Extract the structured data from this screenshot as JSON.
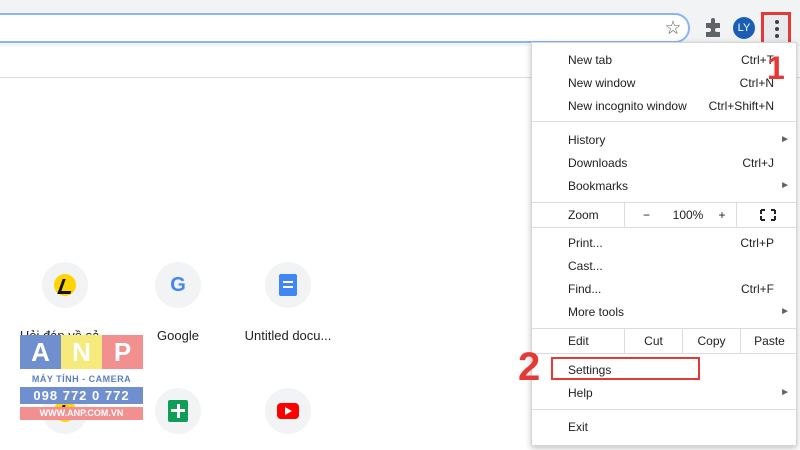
{
  "toolbar": {
    "avatar_initials": "LY",
    "icons": [
      "star-icon",
      "puzzle-icon",
      "kebab-menu-icon"
    ]
  },
  "tiles": [
    {
      "label": "Hỏi đáp về sả...",
      "icon": "runner-icon"
    },
    {
      "label": "Google",
      "icon": "google-icon"
    },
    {
      "label": "Untitled docu...",
      "icon": "docs-icon"
    },
    {
      "label": "",
      "icon": "runner-icon"
    },
    {
      "label": "",
      "icon": "sheets-icon"
    },
    {
      "label": "",
      "icon": "youtube-icon"
    }
  ],
  "watermark": {
    "letters": [
      "A",
      "N",
      "P"
    ],
    "subtitle": "MÁY TÍNH - CAMERA",
    "phone": "098 772 0 772",
    "site": "WWW.ANP.COM.VN"
  },
  "menu": {
    "group1": [
      {
        "label": "New tab",
        "shortcut": "Ctrl+T"
      },
      {
        "label": "New window",
        "shortcut": "Ctrl+N"
      },
      {
        "label": "New incognito window",
        "shortcut": "Ctrl+Shift+N"
      }
    ],
    "group2": [
      {
        "label": "History",
        "shortcut": "",
        "arrow": "►"
      },
      {
        "label": "Downloads",
        "shortcut": "Ctrl+J"
      },
      {
        "label": "Bookmarks",
        "shortcut": "",
        "arrow": "►"
      }
    ],
    "zoom": {
      "label": "Zoom",
      "minus": "−",
      "value": "100%",
      "plus": "+"
    },
    "group3": [
      {
        "label": "Print...",
        "shortcut": "Ctrl+P"
      },
      {
        "label": "Cast...",
        "shortcut": ""
      },
      {
        "label": "Find...",
        "shortcut": "Ctrl+F"
      },
      {
        "label": "More tools",
        "shortcut": "",
        "arrow": "►"
      }
    ],
    "edit": {
      "label": "Edit",
      "cut": "Cut",
      "copy": "Copy",
      "paste": "Paste"
    },
    "settings": "Settings",
    "help": {
      "label": "Help",
      "arrow": "►"
    },
    "exit": "Exit"
  },
  "annotations": {
    "step1": "1",
    "step2": "2",
    "highlight_color": "#e53935"
  }
}
